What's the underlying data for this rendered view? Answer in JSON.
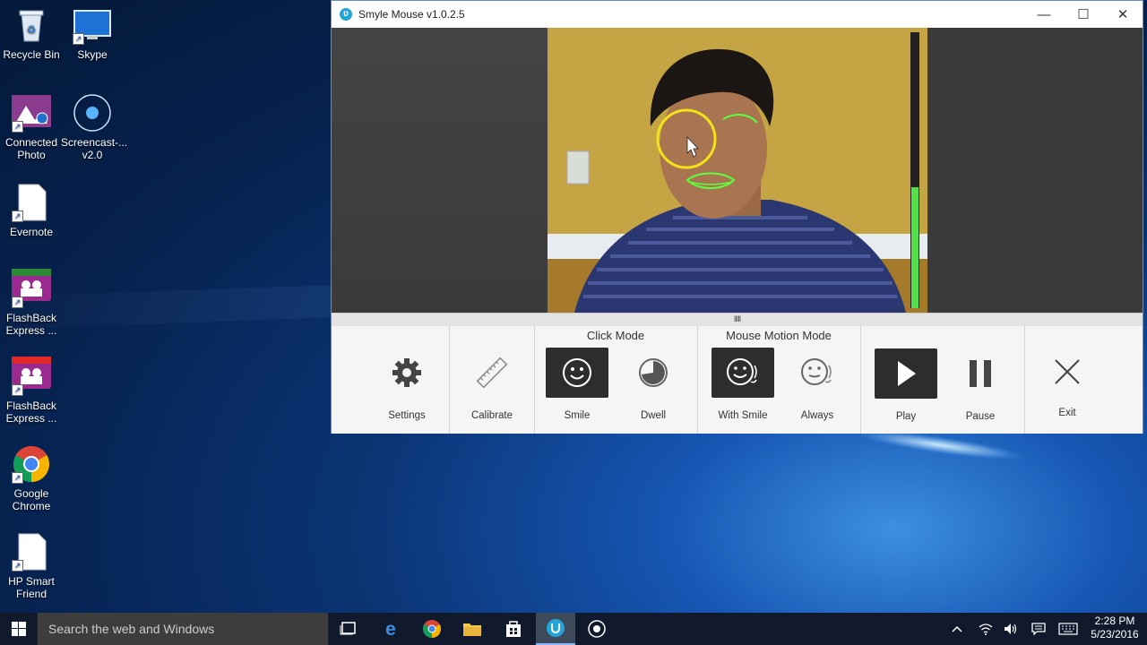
{
  "desktop": {
    "icons": [
      {
        "label": "Recycle Bin"
      },
      {
        "label": "Skype"
      },
      {
        "label": "Connected Photo"
      },
      {
        "label": "Screencast-... v2.0"
      },
      {
        "label": "Evernote"
      },
      {
        "label": "FlashBack Express ..."
      },
      {
        "label": "FlashBack Express ..."
      },
      {
        "label": "Google Chrome"
      },
      {
        "label": "HP Smart Friend"
      }
    ]
  },
  "window": {
    "title": "Smyle Mouse v1.0.2.5",
    "app_icon_glyph": "ʋ",
    "minimize_glyph": "—",
    "maximize_glyph": "☐",
    "close_glyph": "✕",
    "splitter_glyph": "IIIII",
    "toolbar": {
      "settings": "Settings",
      "calibrate": "Calibrate",
      "click_mode_title": "Click Mode",
      "smile": "Smile",
      "dwell": "Dwell",
      "motion_mode_title": "Mouse Motion Mode",
      "with_smile": "With Smile",
      "always": "Always",
      "play": "Play",
      "pause": "Pause",
      "exit": "Exit"
    },
    "smile_level": 0.44
  },
  "taskbar": {
    "search_placeholder": "Search the web and Windows",
    "time": "2:28 PM",
    "date": "5/23/2016"
  }
}
